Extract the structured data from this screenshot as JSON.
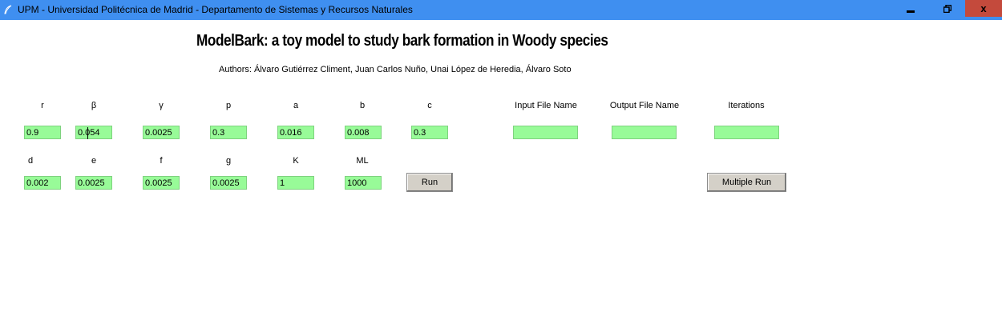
{
  "window": {
    "title": "UPM - Universidad Politécnica de Madrid - Departamento de Sistemas y Recursos Naturales",
    "controls": {
      "close_symbol": "x"
    },
    "titlebar_color": "#3f8ff0",
    "close_color": "#c44a3c"
  },
  "header": {
    "title": "ModelBark: a toy model to study bark formation in Woody species",
    "authors": "Authors: Álvaro Gutiérrez Climent, Juan Carlos Nuño, Unai López de Heredia, Álvaro Soto"
  },
  "params_row1": [
    {
      "label": "r",
      "value": "0.9"
    },
    {
      "label": "β",
      "value": "0.054"
    },
    {
      "label": "γ",
      "value": "0.0025"
    },
    {
      "label": "p",
      "value": "0.3"
    },
    {
      "label": "a",
      "value": "0.016"
    },
    {
      "label": "b",
      "value": "0.008"
    },
    {
      "label": "c",
      "value": "0.3"
    }
  ],
  "files": [
    {
      "label": "Input File Name",
      "value": ""
    },
    {
      "label": "Output File Name",
      "value": ""
    },
    {
      "label": "Iterations",
      "value": ""
    }
  ],
  "params_row2": [
    {
      "label": "d",
      "value": "0.002"
    },
    {
      "label": "e",
      "value": "0.0025"
    },
    {
      "label": "f",
      "value": "0.0025"
    },
    {
      "label": "g",
      "value": "0.0025"
    },
    {
      "label": "K",
      "value": "1"
    },
    {
      "label": "ML",
      "value": "1000"
    }
  ],
  "buttons": {
    "run": "Run",
    "multiple_run": "Multiple Run"
  },
  "colors": {
    "input_bg": "#98fb98",
    "button_bg": "#d4d0c8"
  }
}
